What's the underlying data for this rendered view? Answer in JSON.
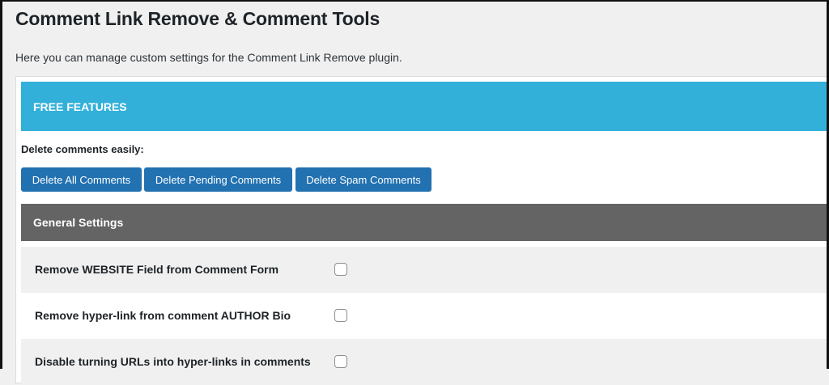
{
  "page": {
    "title": "Comment Link Remove & Comment Tools",
    "description": "Here you can manage custom settings for the Comment Link Remove plugin."
  },
  "free_features": {
    "heading": "FREE FEATURES",
    "delete_label": "Delete comments easily:",
    "buttons": {
      "delete_all": "Delete All Comments",
      "delete_pending": "Delete Pending Comments",
      "delete_spam": "Delete Spam Comments"
    }
  },
  "general_settings": {
    "heading": "General Settings",
    "options": [
      {
        "label": "Remove WEBSITE Field from Comment Form",
        "checked": false
      },
      {
        "label": "Remove hyper-link from comment AUTHOR Bio",
        "checked": false
      },
      {
        "label": "Disable turning URLs into hyper-links in comments",
        "checked": false
      }
    ]
  },
  "colors": {
    "free_header": "#33b0da",
    "general_header": "#646464",
    "button": "#2271b1"
  }
}
